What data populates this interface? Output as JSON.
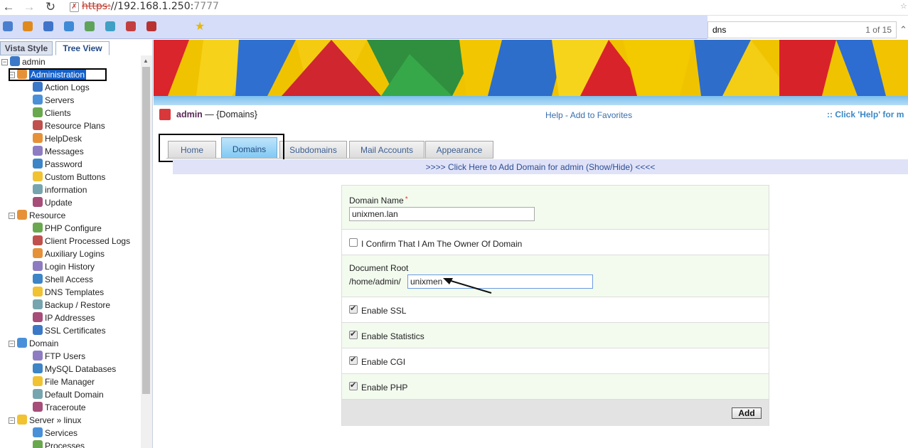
{
  "browser": {
    "back_icon": "arrow-left-icon",
    "forward_icon": "arrow-right-icon",
    "reload_icon": "reload-icon",
    "url_scheme": "https:",
    "url_host": "//192.168.1.250:",
    "url_port": "7777",
    "find_query": "dns",
    "find_count": "1 of 15"
  },
  "sidebar": {
    "tabs": [
      "Vista Style",
      "Tree View"
    ],
    "active_tab": "Tree View",
    "tree": {
      "root": "admin",
      "administration_label": "Administration",
      "administration_items": [
        "Action Logs",
        "Servers",
        "Clients",
        "Resource Plans",
        "HelpDesk",
        "Messages",
        "Password",
        "Custom Buttons",
        "information",
        "Update"
      ],
      "resource_label": "Resource",
      "resource_items": [
        "PHP Configure",
        "Client Processed Logs",
        "Auxiliary Logins",
        "Login History",
        "Shell Access",
        "DNS Templates",
        "Backup / Restore",
        "IP Addresses",
        "SSL Certificates"
      ],
      "domain_label": "Domain",
      "domain_items": [
        "FTP Users",
        "MySQL Databases",
        "File Manager",
        "Default Domain",
        "Traceroute"
      ],
      "server_label": "Server » linux",
      "server_items": [
        "Services",
        "Processes"
      ]
    }
  },
  "header": {
    "user": "admin",
    "separator": " — ",
    "section": "{Domains}",
    "help_link": "Help",
    "link_sep": " - ",
    "favorites_link": "Add to Favorites",
    "help_hint": ":: Click 'Help' for m"
  },
  "tabs": [
    "Home",
    "Domains",
    "Subdomains",
    "Mail Accounts",
    "Appearance"
  ],
  "active_tab": "Domains",
  "add_bar": ">>>> Click Here to Add Domain for admin (Show/Hide) <<<<",
  "form": {
    "domain_name_label": "Domain Name",
    "required_mark": "*",
    "domain_name_value": "unixmen.lan",
    "confirm_owner_label": "I Confirm That I Am The Owner Of Domain",
    "confirm_owner_checked": false,
    "document_root_label": "Document Root",
    "document_root_prefix": "/home/admin/",
    "document_root_value": "unixmen",
    "options": [
      {
        "label": "Enable SSL",
        "checked": true
      },
      {
        "label": "Enable Statistics",
        "checked": true
      },
      {
        "label": "Enable CGI",
        "checked": true
      },
      {
        "label": "Enable PHP",
        "checked": true
      }
    ],
    "add_button": "Add"
  },
  "colors": {
    "toolbar_bg": "#d5ddf9",
    "tree_selection": "#1560c8",
    "active_tab": "#7ec8f3",
    "form_row_bg": "#f3fbef",
    "add_bar_bg": "#e0e2f8"
  }
}
